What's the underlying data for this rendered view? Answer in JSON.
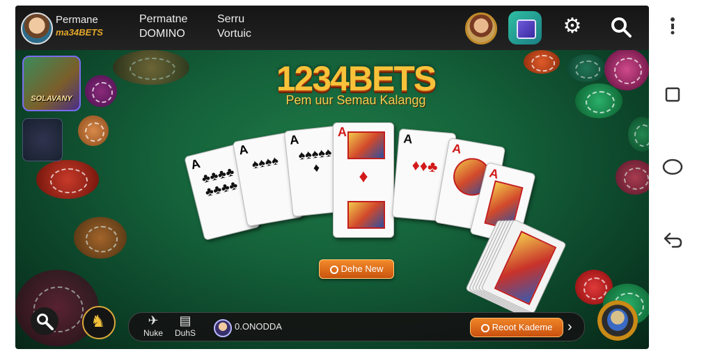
{
  "header": {
    "player_name": "Permane",
    "brand_small": "ma34BETS",
    "game_mode": "Permatne",
    "game_name": "DOMINO",
    "server_a": "Serru",
    "server_b": "Vortuic"
  },
  "side": {
    "thumb1_label": "SOLAVANY"
  },
  "main": {
    "logo": "1234BETS",
    "tagline": "Pem uur Semau Kalangg",
    "new_button": "Dehe New"
  },
  "cards": [
    {
      "rank": "A",
      "suit": "♣",
      "pips": "♣♣♣♣♣♣♣♣",
      "color": "black"
    },
    {
      "rank": "A",
      "suit": "♠",
      "pips": "♠♠♠♠",
      "color": "black"
    },
    {
      "rank": "A",
      "suit": "♦",
      "pips": "♠♠♠♠♠♦",
      "color": "black"
    },
    {
      "rank": "A",
      "suit": "♦",
      "pips": "♦",
      "color": "red"
    },
    {
      "rank": "A",
      "suit": "♠",
      "pips": "♦♦♣",
      "color": "black"
    },
    {
      "rank": "A",
      "suit": "♦",
      "pips": "",
      "color": "red"
    },
    {
      "rank": "A",
      "suit": "♦",
      "pips": "",
      "color": "red"
    }
  ],
  "bottom": {
    "news_label": "Nuke",
    "chat_label": "DuhS",
    "status": "0.ONODDA",
    "reset_button": "Reoot Kademe"
  },
  "colors": {
    "felt": "#14603a",
    "accent_orange": "#f08527",
    "logo_gold": "#f7c23a"
  },
  "icons": [
    "gear-icon",
    "search-icon",
    "zoom-icon",
    "send-icon",
    "chat-icon",
    "chevron-right-icon",
    "back-icon",
    "home-icon",
    "recents-icon"
  ]
}
